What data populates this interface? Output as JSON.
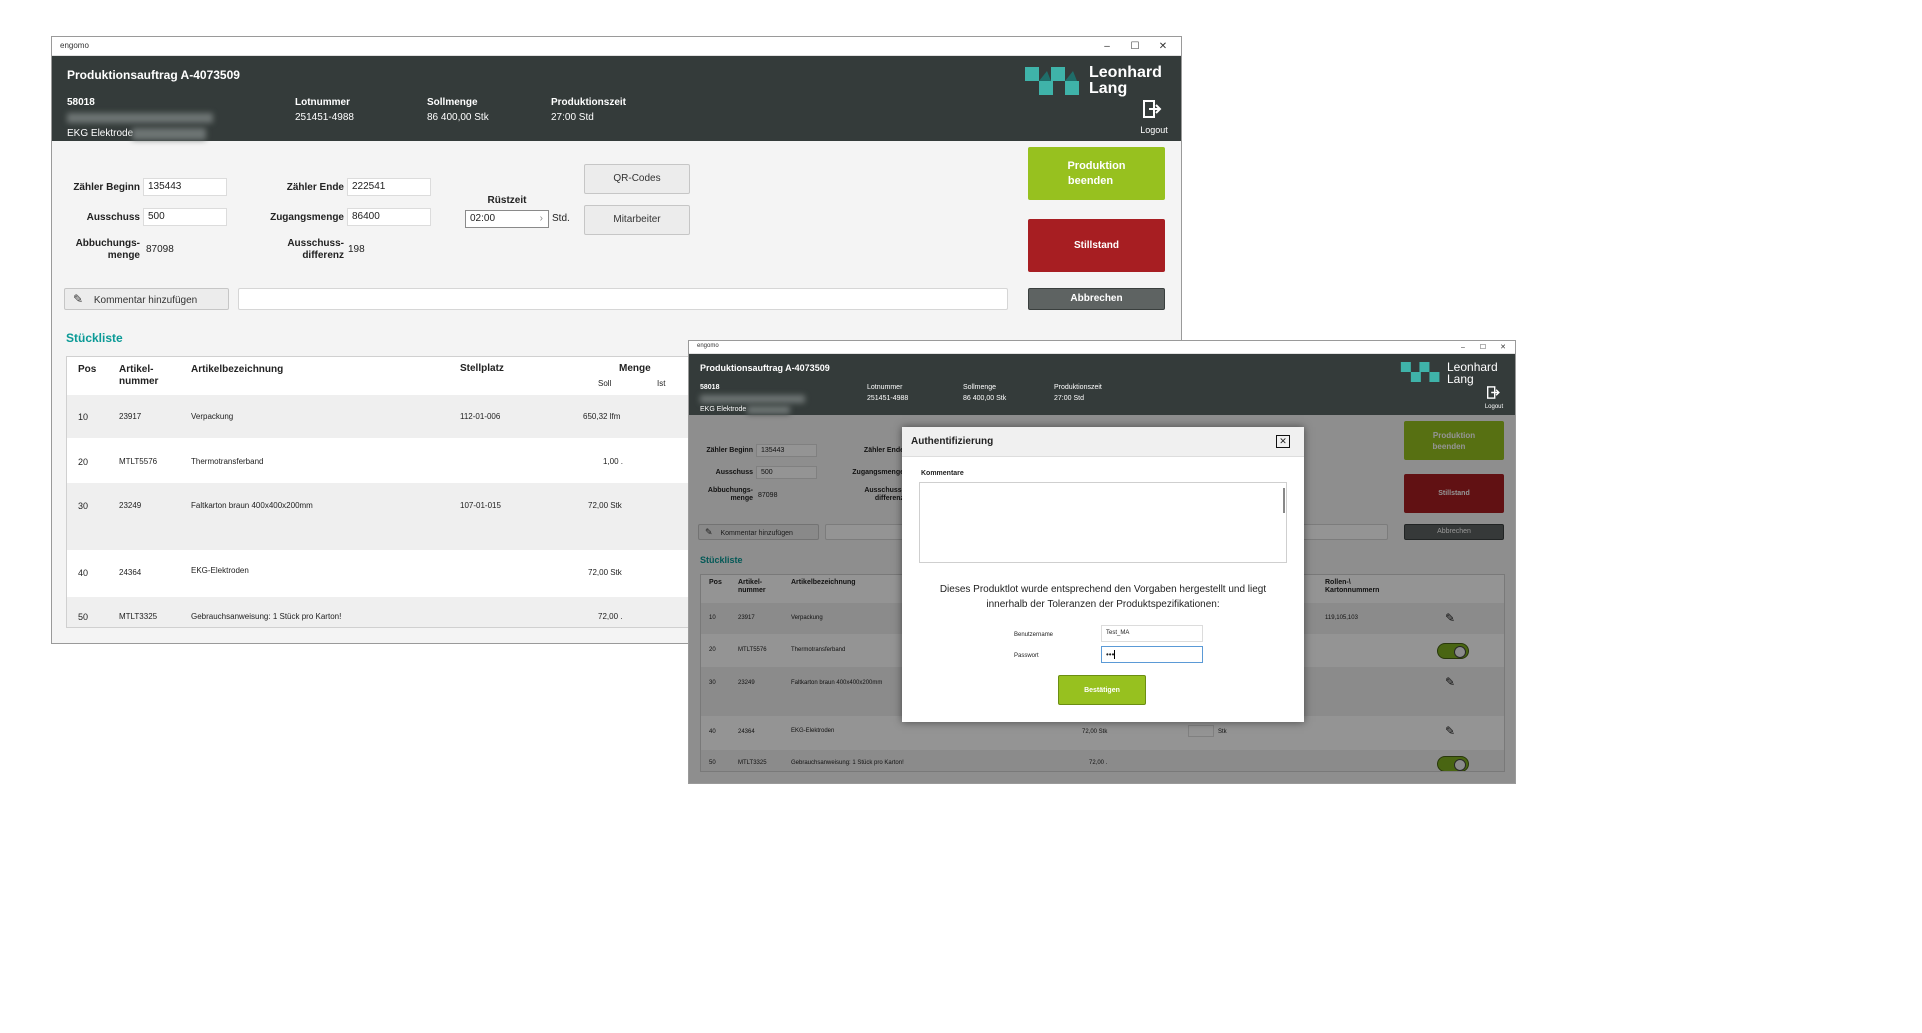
{
  "app_name": "engomo",
  "window_controls": {
    "minimize": "–",
    "maximize": "☐",
    "close": "✕"
  },
  "header": {
    "title": "Produktionsauftrag A-4073509",
    "order_number": "58018",
    "product_name": "EKG Elektrode",
    "lotnummer_label": "Lotnummer",
    "lotnummer_value": "251451-4988",
    "sollmenge_label": "Sollmenge",
    "sollmenge_value": "86 400,00 Stk",
    "produktionszeit_label": "Produktionszeit",
    "produktionszeit_value": "27:00 Std",
    "logo_line1": "Leonhard",
    "logo_line2": "Lang",
    "logout_label": "Logout"
  },
  "form": {
    "zaehler_beginn_label": "Zähler Beginn",
    "zaehler_beginn_value": "135443",
    "zaehler_ende_label": "Zähler Ende",
    "zaehler_ende_value": "222541",
    "ausschuss_label": "Ausschuss",
    "ausschuss_value": "500",
    "zugangsmenge_label": "Zugangsmenge",
    "zugangsmenge_value": "86400",
    "abbuchungsmenge_label_1": "Abbuchungs-",
    "abbuchungsmenge_label_2": "menge",
    "abbuchungsmenge_value": "87098",
    "ausschussdifferenz_label_1": "Ausschuss-",
    "ausschussdifferenz_label_2": "differenz",
    "ausschussdifferenz_value": "198",
    "ruestzeit_label": "Rüstzeit",
    "ruestzeit_value": "02:00",
    "ruestzeit_unit": "Std."
  },
  "buttons": {
    "qr_codes": "QR-Codes",
    "mitarbeiter": "Mitarbeiter",
    "produktion_beenden_1": "Produktion",
    "produktion_beenden_2": "beenden",
    "stillstand": "Stillstand",
    "abbrechen": "Abbrechen",
    "kommentar_hinzufuegen": "Kommentar hinzufügen"
  },
  "stueckliste": {
    "title": "Stückliste",
    "col_pos": "Pos",
    "col_artikelnummer_1": "Artikel-",
    "col_artikelnummer_2": "nummer",
    "col_artikelbezeichnung": "Artikelbezeichnung",
    "col_stellplatz": "Stellplatz",
    "col_menge": "Menge",
    "col_soll": "Soll",
    "col_ist": "Ist",
    "col_rollen_1": "Rollen-\\",
    "col_rollen_2": "Kartonnummern",
    "rows": [
      {
        "pos": "10",
        "artikel": "23917",
        "bezeichnung": "Verpackung",
        "stellplatz": "112-01-006",
        "soll": "650,32 lfm",
        "ist_unit": "",
        "rollen": "119,105,103",
        "action": "edit"
      },
      {
        "pos": "20",
        "artikel": "MTLT5576",
        "bezeichnung": "Thermotransferband",
        "stellplatz": "",
        "soll": "1,00 .",
        "ist_unit": "",
        "rollen": "",
        "action": "toggle"
      },
      {
        "pos": "30",
        "artikel": "23249",
        "bezeichnung": "Faltkarton braun 400x400x200mm",
        "stellplatz": "107-01-015",
        "soll": "72,00 Stk",
        "ist_unit": "",
        "rollen": "",
        "action": "edit"
      },
      {
        "pos": "40",
        "artikel": "24364",
        "bezeichnung": "EKG-Elektroden",
        "stellplatz": "",
        "soll": "72,00 Stk",
        "ist_unit": "Stk",
        "rollen": "",
        "action": "edit"
      },
      {
        "pos": "50",
        "artikel": "MTLT3325",
        "bezeichnung": "Gebrauchsanweisung: 1 Stück pro Karton!",
        "stellplatz": "",
        "soll": "72,00 .",
        "ist_unit": "",
        "rollen": "",
        "action": "toggle"
      }
    ]
  },
  "modal": {
    "title": "Authentifizierung",
    "close": "✕",
    "kommentare_label": "Kommentare",
    "statement_line1": "Dieses Produktlot wurde entsprechend den Vorgaben hergestellt und liegt",
    "statement_line2": "innerhalb der Toleranzen der Produktspezifikationen:",
    "username_label": "Benutzername",
    "username_value": "Test_MA",
    "password_label": "Passwort",
    "password_value": "•••",
    "confirm_button": "Bestätigen"
  },
  "colors": {
    "header_bg": "#343b3a",
    "accent_teal": "#0a9a96",
    "green": "#97c11f",
    "red": "#a71e22",
    "dark_button": "#5e6362",
    "logo_teal": "#3fb3a9"
  }
}
